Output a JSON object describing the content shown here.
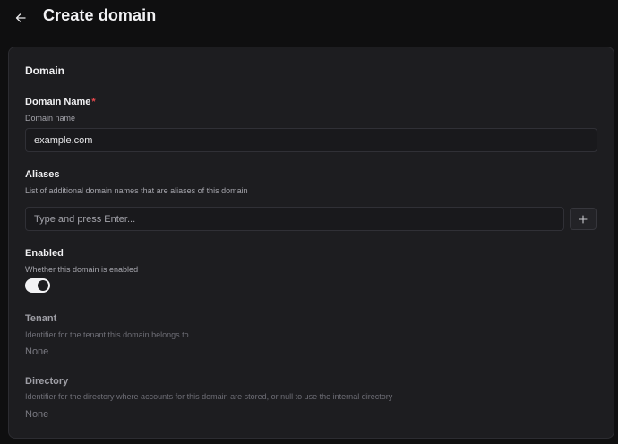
{
  "header": {
    "back_label": "←",
    "title": "Create domain"
  },
  "card": {
    "section_title": "Domain",
    "domain_name": {
      "label": "Domain Name",
      "required_marker": "*",
      "help": "Domain name",
      "value": "example.com"
    },
    "aliases": {
      "label": "Aliases",
      "help": "List of additional domain names that are aliases of this domain",
      "placeholder": "Type and press Enter...",
      "add_label": "+"
    },
    "enabled": {
      "label": "Enabled",
      "help": "Whether this domain is enabled",
      "checked": true
    },
    "tenant": {
      "label": "Tenant",
      "help": "Identifier for the tenant this domain belongs to",
      "value": "None"
    },
    "directory": {
      "label": "Directory",
      "help": "Identifier for the directory where accounts for this domain are stored, or null to use the internal directory",
      "value": "None"
    }
  },
  "colors": {
    "background": "#0f0f10",
    "card": "#1d1d20",
    "required": "#e5484d"
  }
}
